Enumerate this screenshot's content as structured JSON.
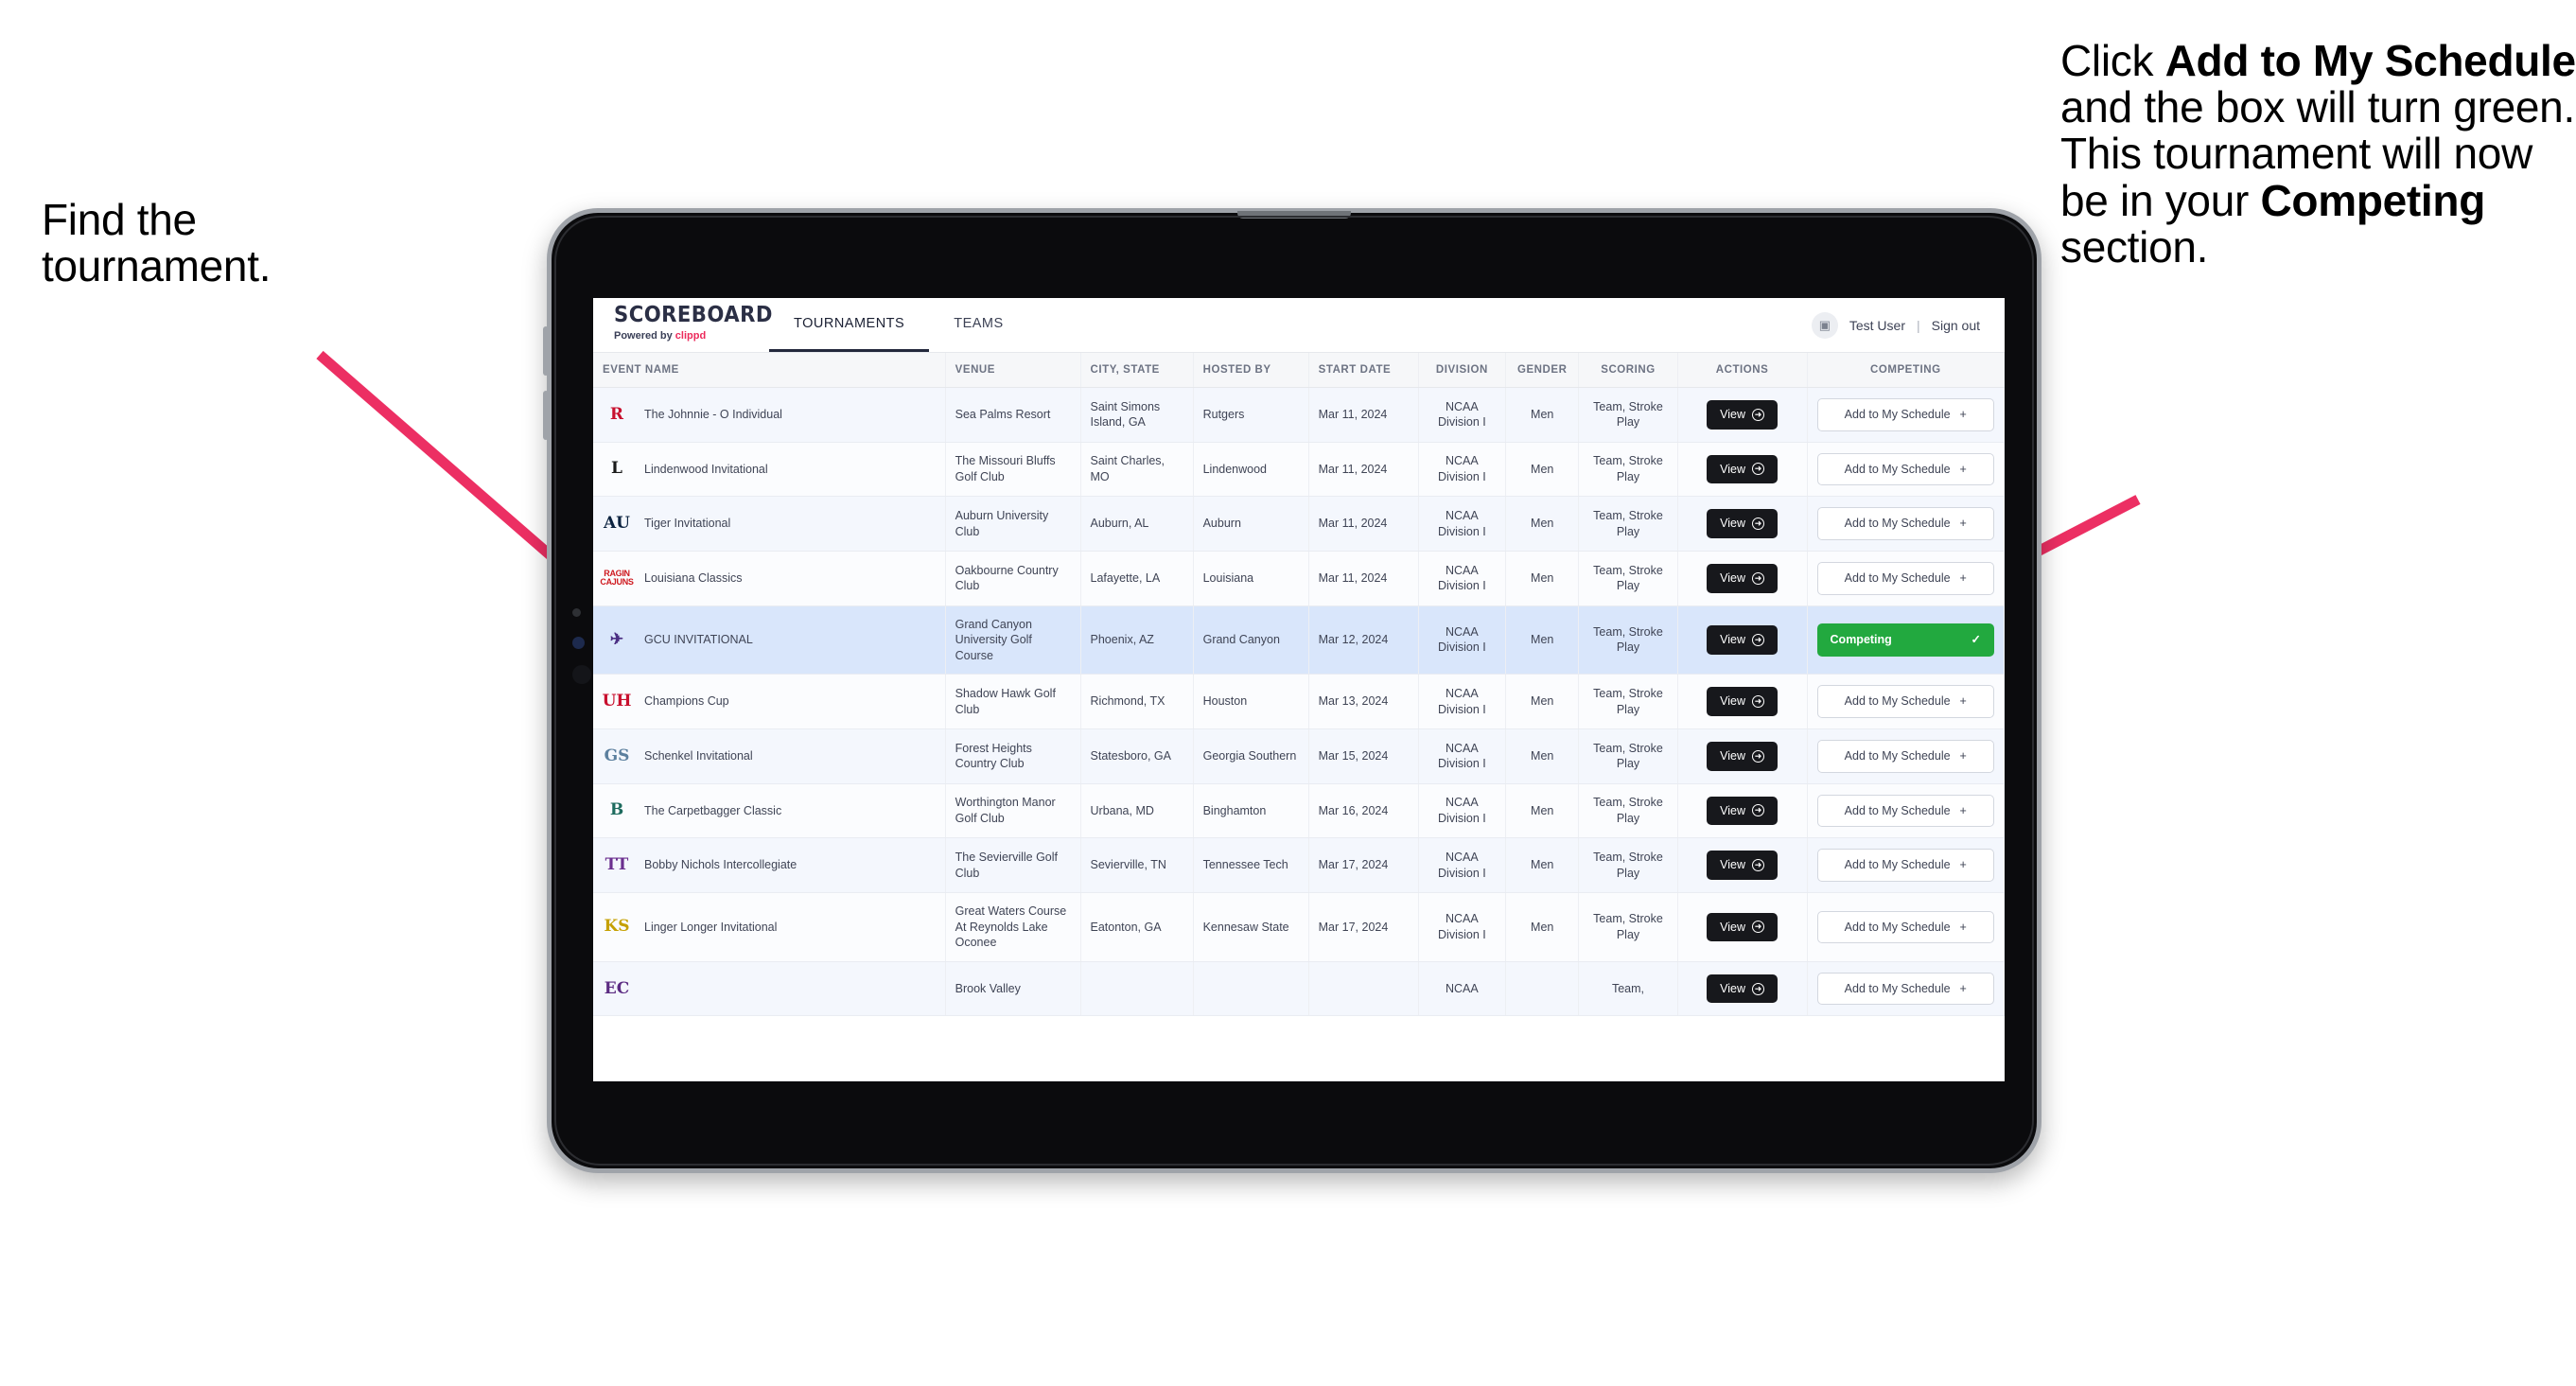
{
  "annotations": {
    "left": {
      "line1": "Find the",
      "line2": "tournament."
    },
    "right": {
      "seg1": "Click ",
      "bold1": "Add to My Schedule",
      "seg2": " and the box will turn green. This tournament will now be in your ",
      "bold2": "Competing",
      "seg3": " section."
    },
    "arrow_color": "#ec2f63"
  },
  "app": {
    "brand": {
      "title": "SCOREBOARD",
      "powered_prefix": "Powered by ",
      "powered_name": "clippd"
    },
    "nav": [
      {
        "label": "TOURNAMENTS",
        "active": true
      },
      {
        "label": "TEAMS",
        "active": false
      }
    ],
    "user": {
      "avatar_icon": "user-avatar-icon",
      "name": "Test User",
      "separator": "|",
      "signout": "Sign out"
    },
    "table": {
      "columns": [
        "EVENT NAME",
        "VENUE",
        "CITY, STATE",
        "HOSTED BY",
        "START DATE",
        "DIVISION",
        "GENDER",
        "SCORING",
        "ACTIONS",
        "COMPETING"
      ],
      "view_label": "View",
      "add_label": "Add to My Schedule",
      "add_plus": "+",
      "competing_label": "Competing",
      "competing_check": "✓",
      "rows": [
        {
          "logo_text": "R",
          "logo_color": "#c8102e",
          "event": "The Johnnie - O Individual",
          "venue": "Sea Palms Resort",
          "city": "Saint Simons Island, GA",
          "hosted_by": "Rutgers",
          "start_date": "Mar 11, 2024",
          "division": "NCAA Division I",
          "gender": "Men",
          "scoring": "Team, Stroke Play",
          "competing": false
        },
        {
          "logo_text": "L",
          "logo_color": "#1a1a1a",
          "event": "Lindenwood Invitational",
          "venue": "The Missouri Bluffs Golf Club",
          "city": "Saint Charles, MO",
          "hosted_by": "Lindenwood",
          "start_date": "Mar 11, 2024",
          "division": "NCAA Division I",
          "gender": "Men",
          "scoring": "Team, Stroke Play",
          "competing": false
        },
        {
          "logo_text": "AU",
          "logo_color": "#0c2340",
          "event": "Tiger Invitational",
          "venue": "Auburn University Club",
          "city": "Auburn, AL",
          "hosted_by": "Auburn",
          "start_date": "Mar 11, 2024",
          "division": "NCAA Division I",
          "gender": "Men",
          "scoring": "Team, Stroke Play",
          "competing": false
        },
        {
          "logo_text": "RAGIN CAJUNS",
          "logo_color": "#ce181e",
          "logo_generic": true,
          "event": "Louisiana Classics",
          "venue": "Oakbourne Country Club",
          "city": "Lafayette, LA",
          "hosted_by": "Louisiana",
          "start_date": "Mar 11, 2024",
          "division": "NCAA Division I",
          "gender": "Men",
          "scoring": "Team, Stroke Play",
          "competing": false
        },
        {
          "logo_text": "✈",
          "logo_color": "#4b2e83",
          "event": "GCU INVITATIONAL",
          "venue": "Grand Canyon University Golf Course",
          "city": "Phoenix, AZ",
          "hosted_by": "Grand Canyon",
          "start_date": "Mar 12, 2024",
          "division": "NCAA Division I",
          "gender": "Men",
          "scoring": "Team, Stroke Play",
          "competing": true,
          "selected": true
        },
        {
          "logo_text": "UH",
          "logo_color": "#c8102e",
          "event": "Champions Cup",
          "venue": "Shadow Hawk Golf Club",
          "city": "Richmond, TX",
          "hosted_by": "Houston",
          "start_date": "Mar 13, 2024",
          "division": "NCAA Division I",
          "gender": "Men",
          "scoring": "Team, Stroke Play",
          "competing": false
        },
        {
          "logo_text": "GS",
          "logo_color": "#5b7f9e",
          "event": "Schenkel Invitational",
          "venue": "Forest Heights Country Club",
          "city": "Statesboro, GA",
          "hosted_by": "Georgia Southern",
          "start_date": "Mar 15, 2024",
          "division": "NCAA Division I",
          "gender": "Men",
          "scoring": "Team, Stroke Play",
          "competing": false
        },
        {
          "logo_text": "B",
          "logo_color": "#1d6b5e",
          "event": "The Carpetbagger Classic",
          "venue": "Worthington Manor Golf Club",
          "city": "Urbana, MD",
          "hosted_by": "Binghamton",
          "start_date": "Mar 16, 2024",
          "division": "NCAA Division I",
          "gender": "Men",
          "scoring": "Team, Stroke Play",
          "competing": false
        },
        {
          "logo_text": "TT",
          "logo_color": "#6b2f8f",
          "event": "Bobby Nichols Intercollegiate",
          "venue": "The Sevierville Golf Club",
          "city": "Sevierville, TN",
          "hosted_by": "Tennessee Tech",
          "start_date": "Mar 17, 2024",
          "division": "NCAA Division I",
          "gender": "Men",
          "scoring": "Team, Stroke Play",
          "competing": false
        },
        {
          "logo_text": "KS",
          "logo_color": "#c5a000",
          "event": "Linger Longer Invitational",
          "venue": "Great Waters Course At Reynolds Lake Oconee",
          "city": "Eatonton, GA",
          "hosted_by": "Kennesaw State",
          "start_date": "Mar 17, 2024",
          "division": "NCAA Division I",
          "gender": "Men",
          "scoring": "Team, Stroke Play",
          "competing": false
        },
        {
          "logo_text": "EC",
          "logo_color": "#5b2b82",
          "event": "",
          "venue": "Brook Valley",
          "city": "",
          "hosted_by": "",
          "start_date": "",
          "division": "NCAA",
          "gender": "",
          "scoring": "Team,",
          "competing": false,
          "partial": true
        }
      ]
    }
  }
}
